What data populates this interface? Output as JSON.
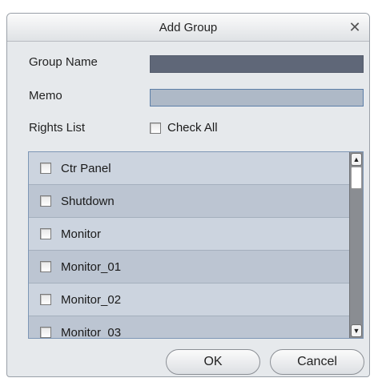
{
  "dialog": {
    "title": "Add Group",
    "close_glyph": "✕"
  },
  "form": {
    "group_name_label": "Group Name",
    "group_name_value": "",
    "memo_label": "Memo",
    "memo_value": "",
    "rights_label": "Rights List",
    "check_all_label": "Check All",
    "check_all_checked": false
  },
  "rights": [
    {
      "label": "Ctr Panel",
      "checked": false
    },
    {
      "label": "Shutdown",
      "checked": false
    },
    {
      "label": "Monitor",
      "checked": false
    },
    {
      "label": "Monitor_01",
      "checked": false
    },
    {
      "label": "Monitor_02",
      "checked": false
    },
    {
      "label": "Monitor_03",
      "checked": false
    }
  ],
  "scrollbar": {
    "up_glyph": "▲",
    "down_glyph": "▼"
  },
  "buttons": {
    "ok": "OK",
    "cancel": "Cancel"
  }
}
